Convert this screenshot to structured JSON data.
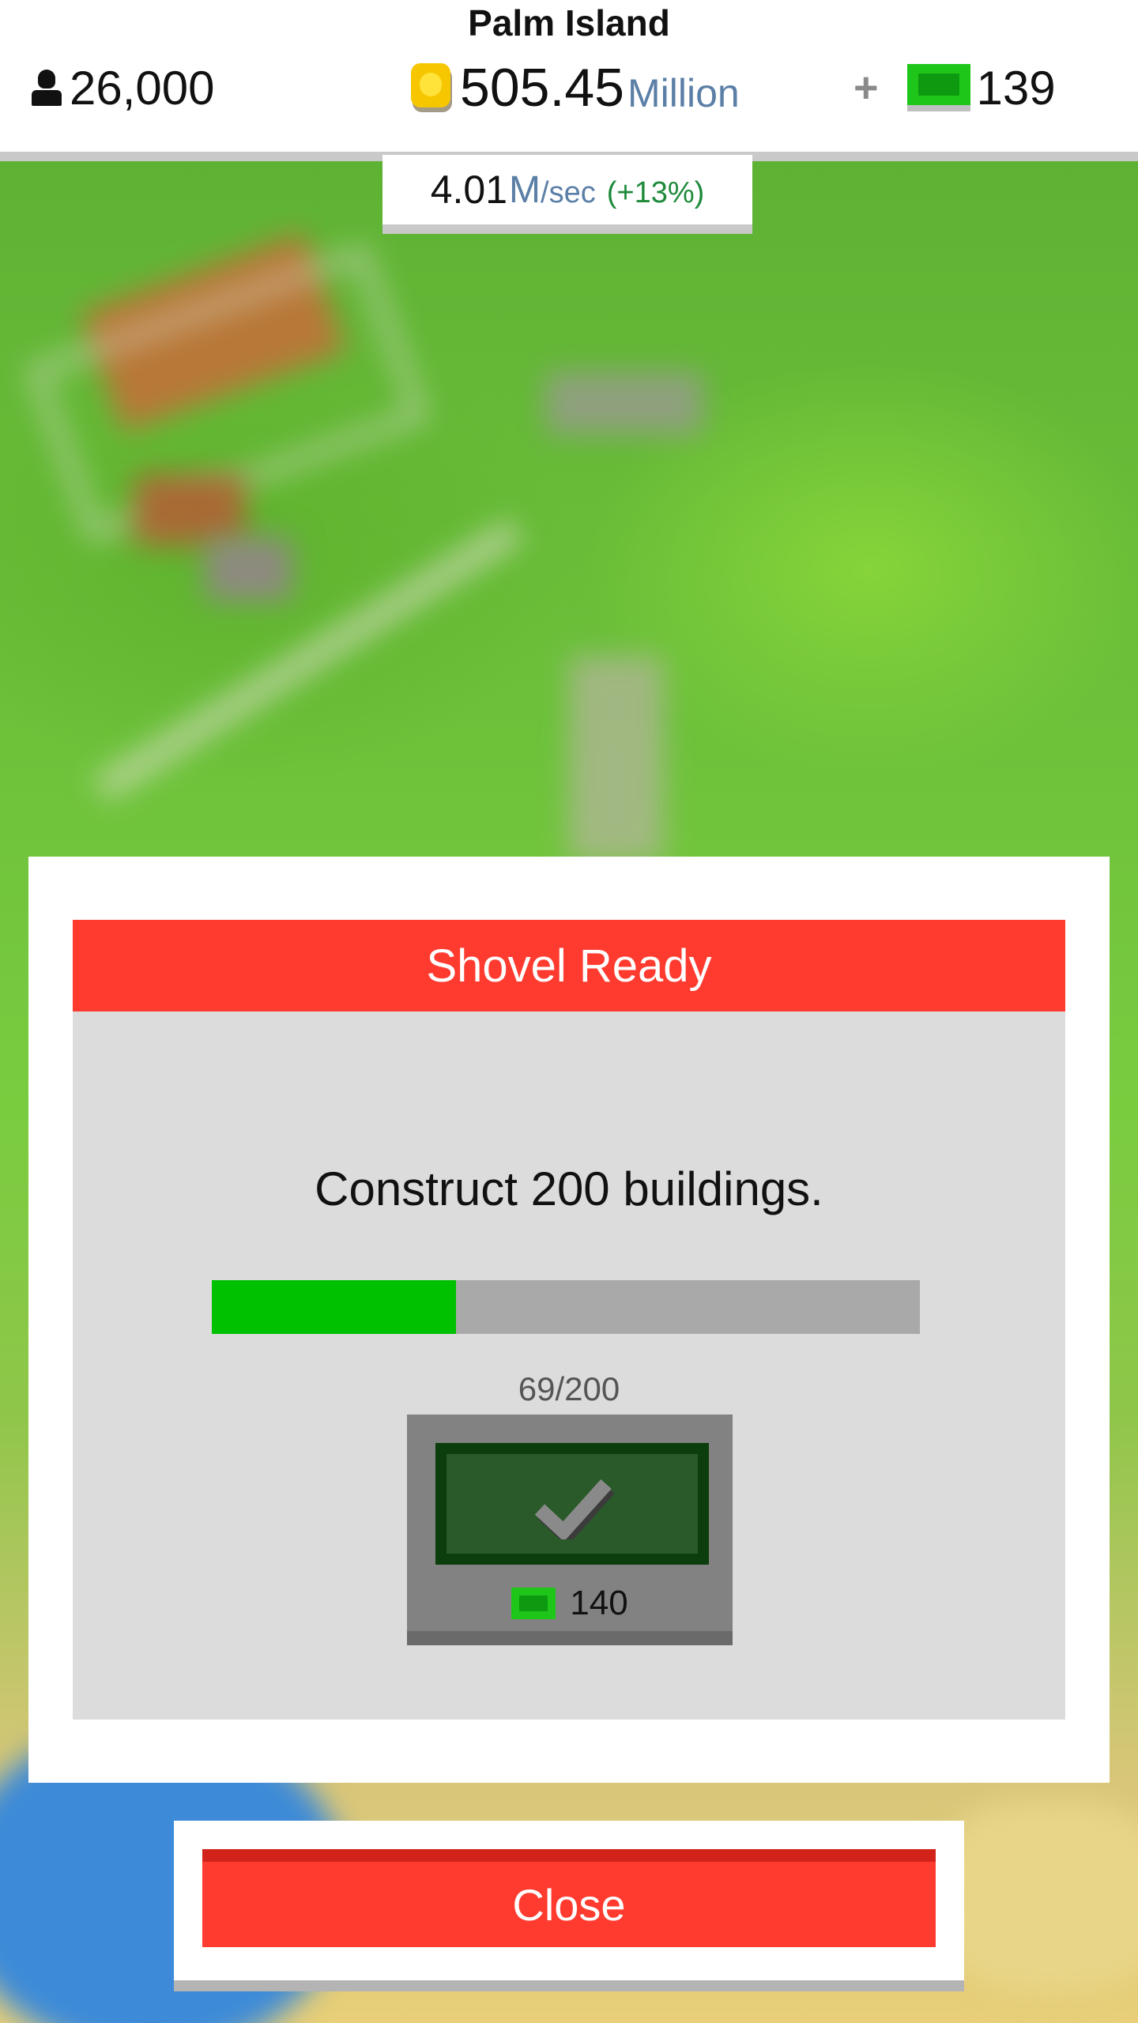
{
  "hud": {
    "island_name": "Palm Island",
    "population": "26,000",
    "money_value": "505.45",
    "money_unit": "Million",
    "gems": "139",
    "rate_value": "4.01",
    "rate_unit": "M",
    "rate_unit_sec": "/sec",
    "rate_bonus": "(+13%)"
  },
  "dialog": {
    "title": "Shovel Ready",
    "description": "Construct 200 buildings.",
    "progress_current": 69,
    "progress_total": 200,
    "progress_text": "69/200",
    "reward_gems": "140"
  },
  "close_label": "Close",
  "colors": {
    "accent_red": "#ff3b30",
    "progress_green": "#00c100",
    "gem_green": "#1fc61a",
    "coin_gold": "#f6c700",
    "money_unit_blue": "#5b7fa6",
    "bonus_green": "#1e8a3a"
  },
  "icons": {
    "population": "person-icon",
    "money": "coin-icon",
    "gems": "gem-icon",
    "add_gems": "plus-icon",
    "claim": "checkmark-icon"
  }
}
